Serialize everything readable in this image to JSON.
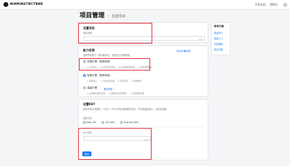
{
  "brand": {
    "name": "ЖИМЖЕТИСТВИЕ"
  },
  "topbar": {
    "links": [
      "开发文档",
      "控制台"
    ]
  },
  "header": {
    "title": "项目管理",
    "crumb": "创建项目"
  },
  "project": {
    "title": "设置项目",
    "name_label": "项目名称",
    "counter": "0/20"
  },
  "permission": {
    "title": "能力权限",
    "desc": "选择项目能力一般可能存在，请您关注开通权限。",
    "apply_link": "申请开通权限 ›",
    "options": [
      {
        "label": "快速打稿（推荐使用）",
        "link": "",
        "chips": [
          "文字输入",
          "10次文字预览",
          "长文本快速生成",
          "支持语音朗读"
        ]
      },
      {
        "label": "智能打稿（推荐使用）",
        "link": "",
        "chips": [
          "语音输入",
          "大段内容识别",
          "实时转写",
          "多种格式"
        ]
      },
      {
        "label": "高级打稿",
        "link": "服务条款 ›",
        "chips": [
          "全部能力都可使用",
          "需要专业评估审核",
          "支持定制开发"
        ]
      }
    ]
  },
  "key": {
    "title": "设置KEY",
    "desc": "项目开发必须提供一个KEY，KEY为项目调用服务凭证，不可泄露给他人，请妥善保管。",
    "platform_label": "选择平台",
    "platforms": [
      "Web API",
      "iOS SDK",
      "Android SDK"
    ],
    "name_label": "KEY名称",
    "counter": "0/20"
  },
  "submit": {
    "label": "提交"
  },
  "sidebar": {
    "title": "参考文档",
    "items": [
      "项目简介",
      "快速入门",
      "开发指南",
      "常见问题"
    ]
  },
  "colors": {
    "accent": "#1677ff",
    "highlight": "#e0303a"
  }
}
